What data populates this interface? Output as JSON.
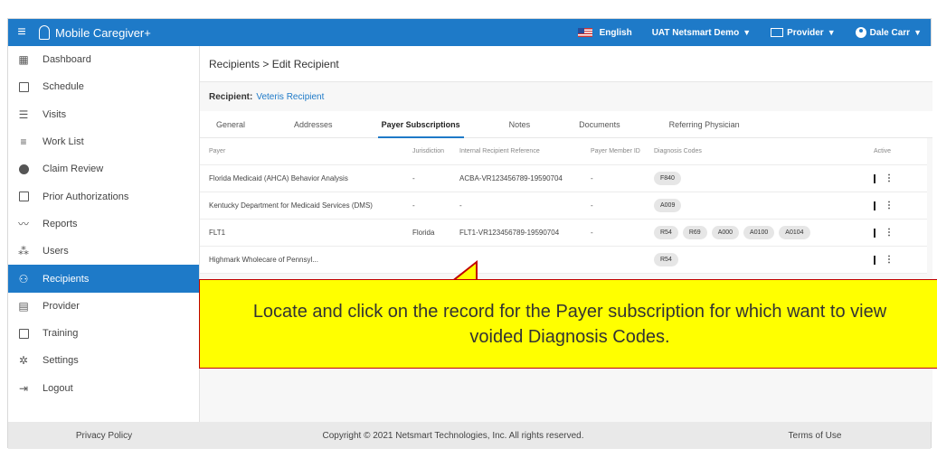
{
  "app": {
    "title": "Mobile Caregiver+",
    "menu_icon": "hamburger-icon"
  },
  "topbar": {
    "language": "English",
    "tenant": "UAT Netsmart Demo",
    "role": "Provider",
    "user": "Dale Carr"
  },
  "sidebar": {
    "items": [
      {
        "label": "Dashboard",
        "icon": "dashboard-icon"
      },
      {
        "label": "Schedule",
        "icon": "calendar-icon"
      },
      {
        "label": "Visits",
        "icon": "filter-icon"
      },
      {
        "label": "Work List",
        "icon": "list-icon"
      },
      {
        "label": "Claim Review",
        "icon": "alert-icon"
      },
      {
        "label": "Prior Authorizations",
        "icon": "calendar-check-icon"
      },
      {
        "label": "Reports",
        "icon": "chart-line-icon"
      },
      {
        "label": "Users",
        "icon": "users-icon"
      },
      {
        "label": "Recipients",
        "icon": "recipients-icon",
        "active": true
      },
      {
        "label": "Provider",
        "icon": "provider-icon"
      },
      {
        "label": "Training",
        "icon": "training-icon"
      },
      {
        "label": "Settings",
        "icon": "gear-icon"
      },
      {
        "label": "Logout",
        "icon": "logout-icon"
      }
    ]
  },
  "main": {
    "breadcrumb": "Recipients > Edit Recipient",
    "recipient_label": "Recipient:",
    "recipient_name": "Veteris Recipient",
    "tabs": [
      "General",
      "Addresses",
      "Payer Subscriptions",
      "Notes",
      "Documents",
      "Referring Physician"
    ],
    "active_tab": "Payer Subscriptions",
    "table": {
      "headers": [
        "Payer",
        "Jurisdiction",
        "Internal Recipient Reference",
        "Payer Member ID",
        "Diagnosis Codes",
        "Active"
      ],
      "rows": [
        {
          "payer": "Florida Medicaid (AHCA) Behavior Analysis",
          "jurisdiction": "-",
          "reference": "ACBA-VR123456789-19590704",
          "member_id": "-",
          "codes": [
            "F840"
          ],
          "active": true
        },
        {
          "payer": "Kentucky Department for Medicaid Services (DMS)",
          "jurisdiction": "-",
          "reference": "-",
          "member_id": "-",
          "codes": [
            "A009"
          ],
          "active": true
        },
        {
          "payer": "FLT1",
          "jurisdiction": "Florida",
          "reference": "FLT1-VR123456789-19590704",
          "member_id": "-",
          "codes": [
            "R54",
            "R69",
            "A000",
            "A0100",
            "A0104"
          ],
          "active": true
        },
        {
          "payer": "Highmark Wholecare of Pennsyl...",
          "jurisdiction": "",
          "reference": "",
          "member_id": "",
          "codes": [
            "R54"
          ],
          "active": false
        }
      ]
    }
  },
  "footer": {
    "privacy": "Privacy Policy",
    "copyright": "Copyright © 2021 Netsmart Technologies, Inc. All rights reserved.",
    "terms": "Terms of Use"
  },
  "callout": {
    "text": "Locate and click on the record for the Payer subscription for which want to view voided Diagnosis Codes."
  },
  "colors": {
    "brand": "#1e7ac8",
    "callout_bg": "#ffff00",
    "callout_border": "#c00000"
  }
}
